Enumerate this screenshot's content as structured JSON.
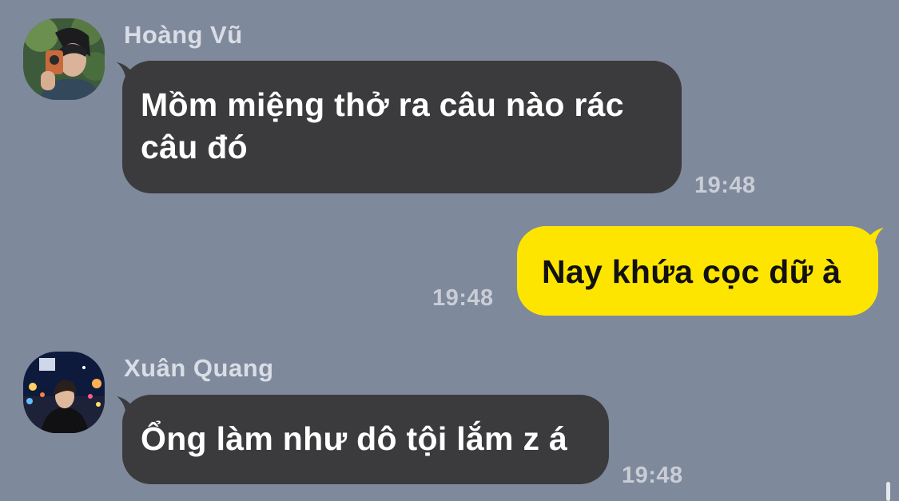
{
  "messages": [
    {
      "sender": "Hoàng Vũ",
      "direction": "incoming",
      "lines": [
        "Mồm miệng thở ra câu nào rác",
        "câu đó"
      ],
      "time": "19:48"
    },
    {
      "direction": "outgoing",
      "text": "Nay khứa cọc dữ à",
      "time": "19:48"
    },
    {
      "sender": "Xuân Quang",
      "direction": "incoming",
      "text": "Ổng làm như dô tội lắm z á",
      "time": "19:48"
    }
  ],
  "colors": {
    "background": "#7f899c",
    "incoming_bubble": "#3b3b3d",
    "outgoing_bubble": "#fee500"
  }
}
